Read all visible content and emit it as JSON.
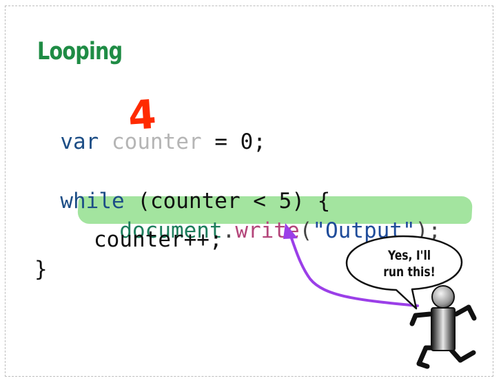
{
  "slide": {
    "title": "Looping",
    "code": {
      "line1": {
        "keyword": "var",
        "var_name": "counter",
        "rest": " = 0;"
      },
      "line3": {
        "keyword": "while",
        "rest": " (counter < 5) {"
      },
      "line4": {
        "object": "document",
        "dot": ".",
        "method": "write",
        "open": "(",
        "string": "\"Output\"",
        "close": ");"
      },
      "line5": "counter++;",
      "line6": "}"
    },
    "annotation": {
      "counter_value": "4",
      "speech": "Yes, I'll run this!"
    }
  },
  "colors": {
    "title": "#1f8c45",
    "keyword": "#1d4e86",
    "highlight": "#8fde8a",
    "arrow": "#9b3fe8",
    "counter_value": "#ff2a00"
  }
}
